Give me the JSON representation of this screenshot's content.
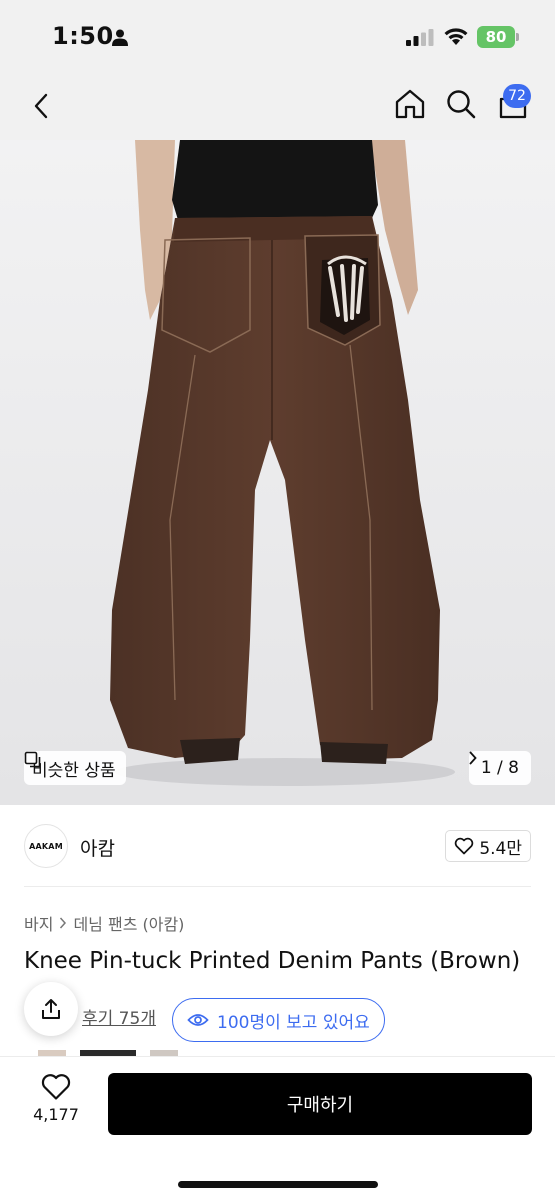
{
  "status_bar": {
    "time": "1:50",
    "battery": "80",
    "icons": [
      "person-icon",
      "signal-icon",
      "wifi-icon",
      "battery-icon"
    ]
  },
  "nav": {
    "icons": [
      "back-icon",
      "home-icon",
      "search-icon",
      "shopping-bag-icon"
    ],
    "cart_count": "72"
  },
  "image": {
    "similar_label": "비슷한 상품",
    "page_indicator": "1 / 8"
  },
  "brand": {
    "logo_text": "AAKAM",
    "name": "아캄",
    "likes": "5.4만"
  },
  "breadcrumb": {
    "category": "바지",
    "subcategory": "데님 팬츠 (아캄)"
  },
  "product": {
    "title": "Knee Pin-tuck Printed Denim Pants (Brown)"
  },
  "reviews": {
    "link_text": "후기 75개",
    "viewers_text": "100명이 보고 있어요"
  },
  "bottom_bar": {
    "wish_count": "4,177",
    "buy_label": "구매하기"
  },
  "colors": {
    "accent": "#3d6cf0",
    "battery": "#65c466",
    "buy_button": "#000000",
    "pants": "#5a3a2c"
  }
}
